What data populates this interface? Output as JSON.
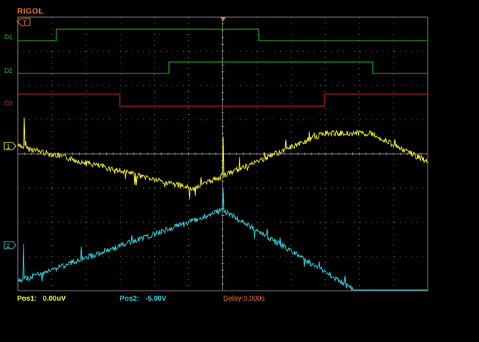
{
  "brand": "RIGOL",
  "markers": {
    "trigger_channel": "T",
    "ch1_label": "1",
    "ch2_label": "2",
    "d1": "D1",
    "d2": "D2",
    "d3": "D3"
  },
  "status": {
    "pos1_label": "Pos1:",
    "pos1_value": "0.00uV",
    "pos2_label": "Pos2:",
    "pos2_value": "-5.00V",
    "delay_label": "Delay:",
    "delay_value": "0.000s"
  },
  "colors": {
    "ch1": "#ffff33",
    "ch2": "#33dde6",
    "d1": "#22cc22",
    "d2": "#22cc22",
    "d3": "#e02020",
    "grid": "#8a8a8a",
    "brand": "#f07c3c",
    "trigger": "#f07c3c"
  }
}
